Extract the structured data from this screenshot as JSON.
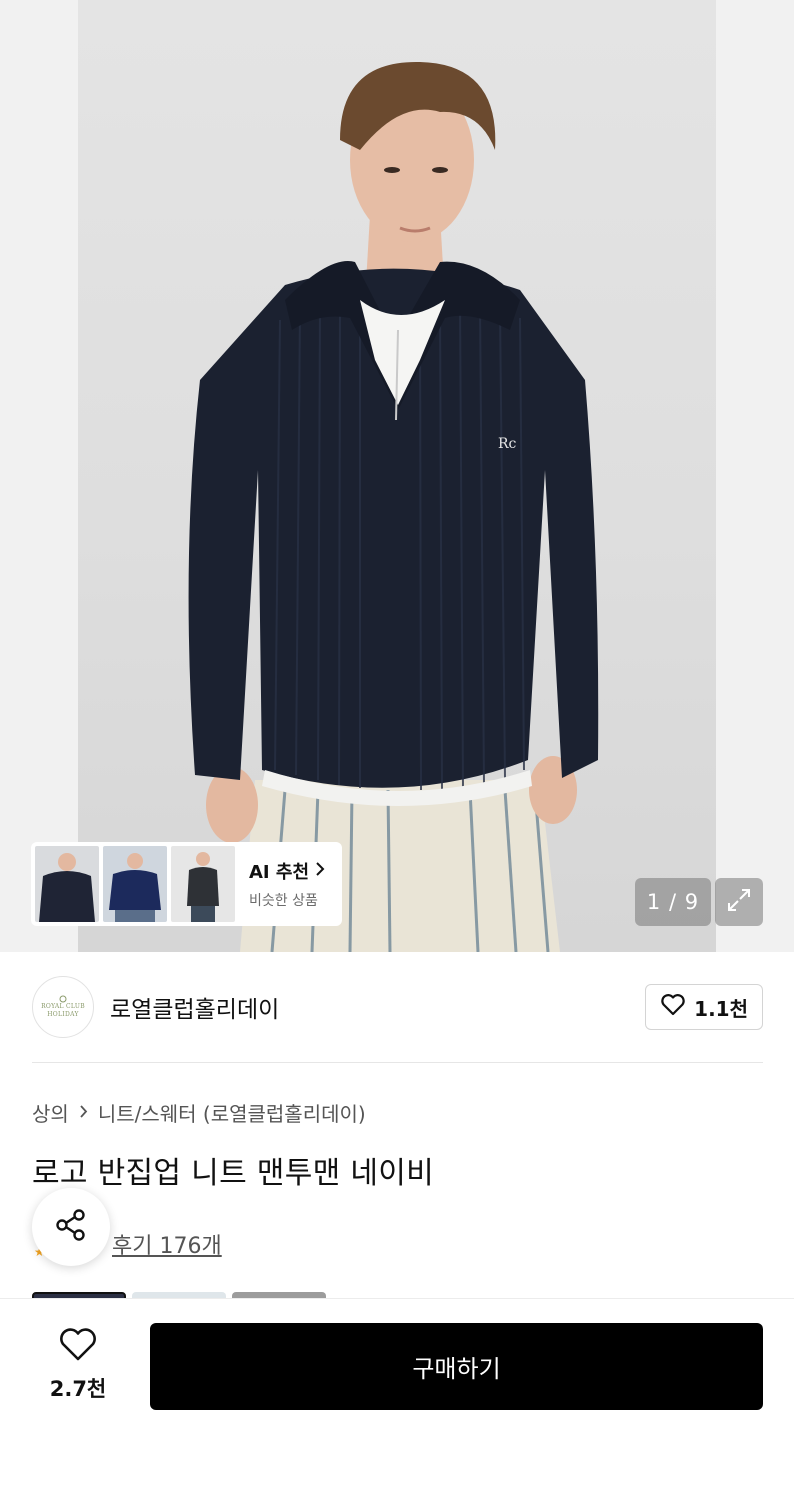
{
  "hero": {
    "pager": "1 / 9",
    "ai_card": {
      "title": "AI 추천",
      "subtitle": "비슷한 상품"
    }
  },
  "brand": {
    "logo_text_line1": "ROYAL CLUB",
    "logo_text_line2": "HOLIDAY",
    "name": "로열클럽홀리데이",
    "like_count": "1.1천"
  },
  "product": {
    "breadcrumb": [
      "상의",
      "니트/스웨터 (로열클럽홀리데이)"
    ],
    "title": "로고 반집업 니트 맨투맨 네이비",
    "review_link": "후기 176개"
  },
  "bottom_bar": {
    "wish_count": "2.7천",
    "buy_label": "구매하기"
  },
  "colors": {
    "navy_knit": "#1b2130",
    "buy_button": "#000000",
    "rating_star": "#f5a623"
  }
}
